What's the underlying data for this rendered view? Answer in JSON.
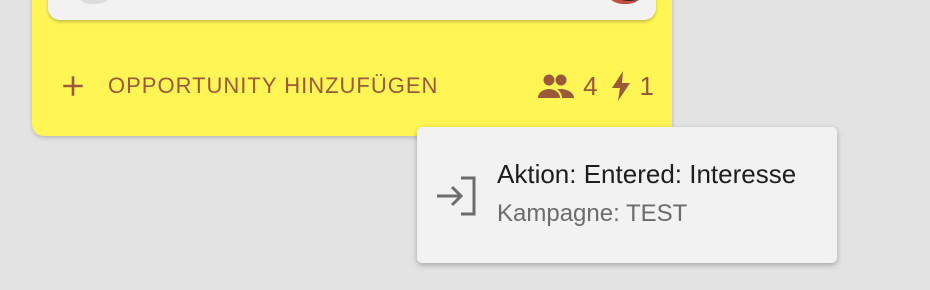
{
  "column": {
    "add_button_label": "OPPORTUNITY HINZUFÜGEN",
    "stats": {
      "members_count": "4",
      "actions_count": "1"
    },
    "accent_color": "#fff656",
    "text_color": "#9a5a3a"
  },
  "popup": {
    "icon": "login-icon",
    "title": "Aktion: Entered: Interesse",
    "subtitle": "Kampagne: TEST"
  }
}
